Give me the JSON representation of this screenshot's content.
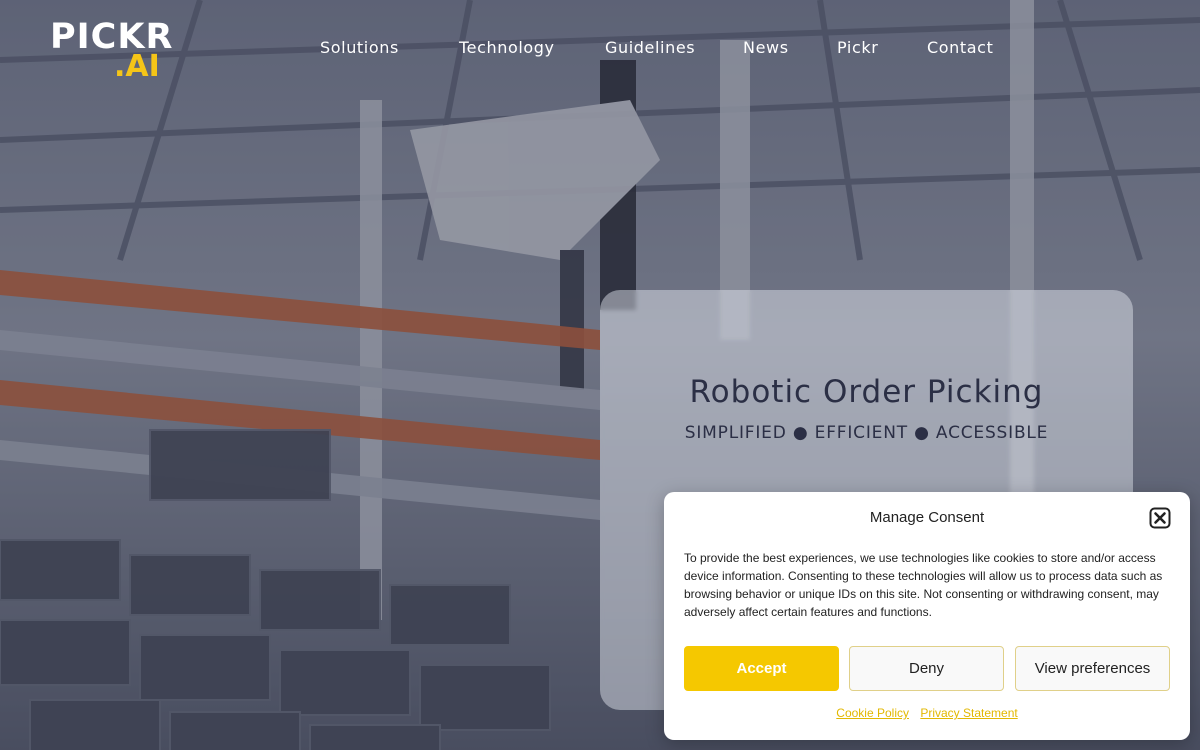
{
  "brand": {
    "logo_top": "PICKR",
    "logo_bottom": ".AI",
    "accent_color": "#f5c518"
  },
  "nav": {
    "items": [
      {
        "label": "Solutions"
      },
      {
        "label": "Technology"
      },
      {
        "label": "Guidelines"
      },
      {
        "label": "News"
      },
      {
        "label": "Pickr"
      },
      {
        "label": "Contact"
      }
    ]
  },
  "hero": {
    "title": "Robotic Order Picking",
    "subtitle": "SIMPLIFIED ● EFFICIENT ● ACCESSIBLE"
  },
  "consent": {
    "title": "Manage Consent",
    "close_icon": "close-icon",
    "text": "To provide the best experiences, we use technologies like cookies to store and/or access device information. Consenting to these technologies will allow us to process data such as browsing behavior or unique IDs on this site. Not consenting or withdrawing consent, may adversely affect certain features and functions.",
    "accept_label": "Accept",
    "deny_label": "Deny",
    "preferences_label": "View preferences",
    "cookie_policy_label": "Cookie Policy",
    "privacy_statement_label": "Privacy Statement",
    "accept_color": "#f5c800"
  }
}
